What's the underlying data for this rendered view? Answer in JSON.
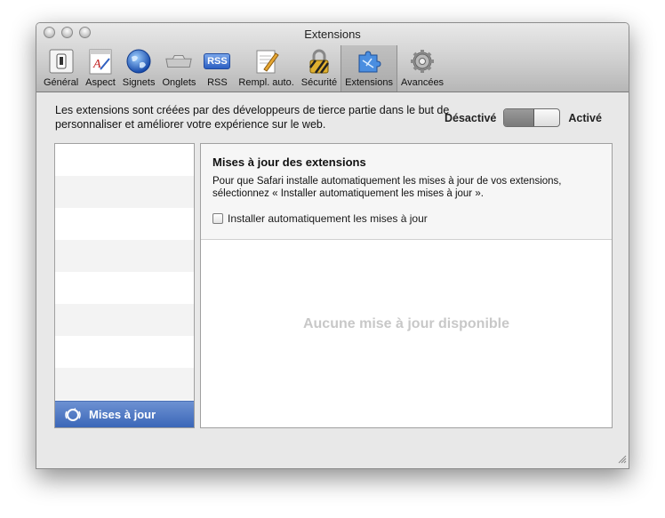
{
  "window": {
    "title": "Extensions"
  },
  "toolbar": {
    "items": [
      {
        "label": "Général",
        "icon": "switch-icon"
      },
      {
        "label": "Aspect",
        "icon": "font-icon"
      },
      {
        "label": "Signets",
        "icon": "globe-icon"
      },
      {
        "label": "Onglets",
        "icon": "tabs-icon"
      },
      {
        "label": "RSS",
        "icon": "rss-icon"
      },
      {
        "label": "Rempl. auto.",
        "icon": "pencil-icon"
      },
      {
        "label": "Sécurité",
        "icon": "lock-icon"
      },
      {
        "label": "Extensions",
        "icon": "puzzle-icon",
        "selected": true
      },
      {
        "label": "Avancées",
        "icon": "gear-icon"
      }
    ],
    "rss_badge": "RSS"
  },
  "description": "Les extensions sont créées par des développeurs de tierce partie dans le but de personnaliser et améliorer votre expérience sur le web.",
  "toggle": {
    "off_label": "Désactivé",
    "on_label": "Activé",
    "state": "off"
  },
  "sidebar": {
    "updates_label": "Mises à jour"
  },
  "detail": {
    "title": "Mises à jour des extensions",
    "body": "Pour que Safari installe automatiquement les mises à jour de vos extensions, sélectionnez « Installer automatiquement les mises à jour ».",
    "checkbox_label": "Installer automatiquement les mises à jour",
    "checkbox_checked": false,
    "empty_message": "Aucune mise à jour disponible"
  },
  "colors": {
    "selection": "#3b67b8",
    "empty_text": "#c8c8c8"
  }
}
